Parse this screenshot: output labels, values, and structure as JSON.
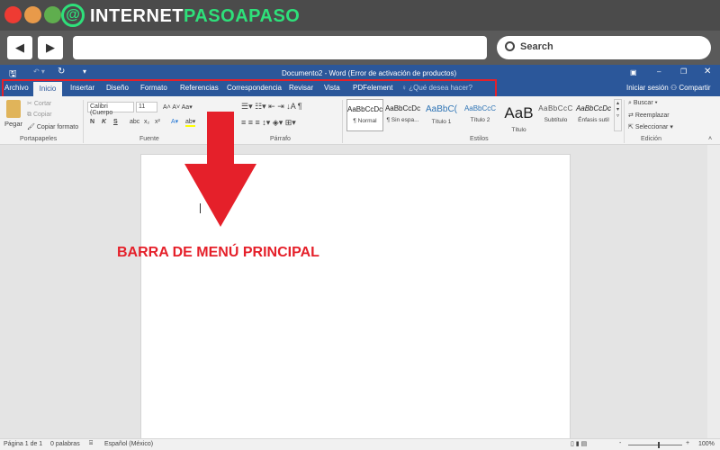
{
  "browser": {
    "brand_white": "INTERNET",
    "brand_green": "PASOAPASO",
    "search_label": "Search",
    "back": "◀",
    "forward": "▶"
  },
  "word": {
    "title": "Documento2 - Word (Error de activación de productos)",
    "tabs": [
      "Archivo",
      "Inicio",
      "Insertar",
      "Diseño",
      "Formato",
      "Referencias",
      "Correspondencia",
      "Revisar",
      "Vista",
      "PDFelement"
    ],
    "tell_me": "¿Qué desea hacer?",
    "sign_in": "Iniciar sesión",
    "share": "Compartir",
    "clipboard": {
      "paste": "Pegar",
      "cut": "Cortar",
      "copy": "Copiar",
      "format_painter": "Copiar formato",
      "group": "Portapapeles"
    },
    "font": {
      "name": "Calibri (Cuerpo",
      "size": "11",
      "group": "Fuente",
      "buttons": [
        "N",
        "K",
        "S",
        "abc",
        "x₂",
        "x²"
      ]
    },
    "paragraph": {
      "group": "Párrafo"
    },
    "styles": {
      "group": "Estilos",
      "items": [
        {
          "preview": "AaBbCcDc",
          "name": "¶ Normal"
        },
        {
          "preview": "AaBbCcDc",
          "name": "¶ Sin espa..."
        },
        {
          "preview": "AaBbC(",
          "name": "Título 1"
        },
        {
          "preview": "AaBbCcC",
          "name": "Título 2"
        },
        {
          "preview": "AaB",
          "name": "Título"
        },
        {
          "preview": "AaBbCcC",
          "name": "Subtítulo"
        },
        {
          "preview": "AaBbCcDc",
          "name": "Énfasis sutil"
        }
      ]
    },
    "editing": {
      "group": "Edición",
      "find": "Buscar",
      "replace": "Reemplazar",
      "select": "Seleccionar"
    }
  },
  "annotation": "BARRA DE MENÚ PRINCIPAL",
  "status": {
    "page": "Página 1 de 1",
    "words": "0 palabras",
    "language": "Español (México)",
    "zoom": "100%"
  },
  "colors": {
    "word_blue": "#2b579a",
    "annotation_red": "#e5202a",
    "brand_green": "#2ee07a"
  }
}
